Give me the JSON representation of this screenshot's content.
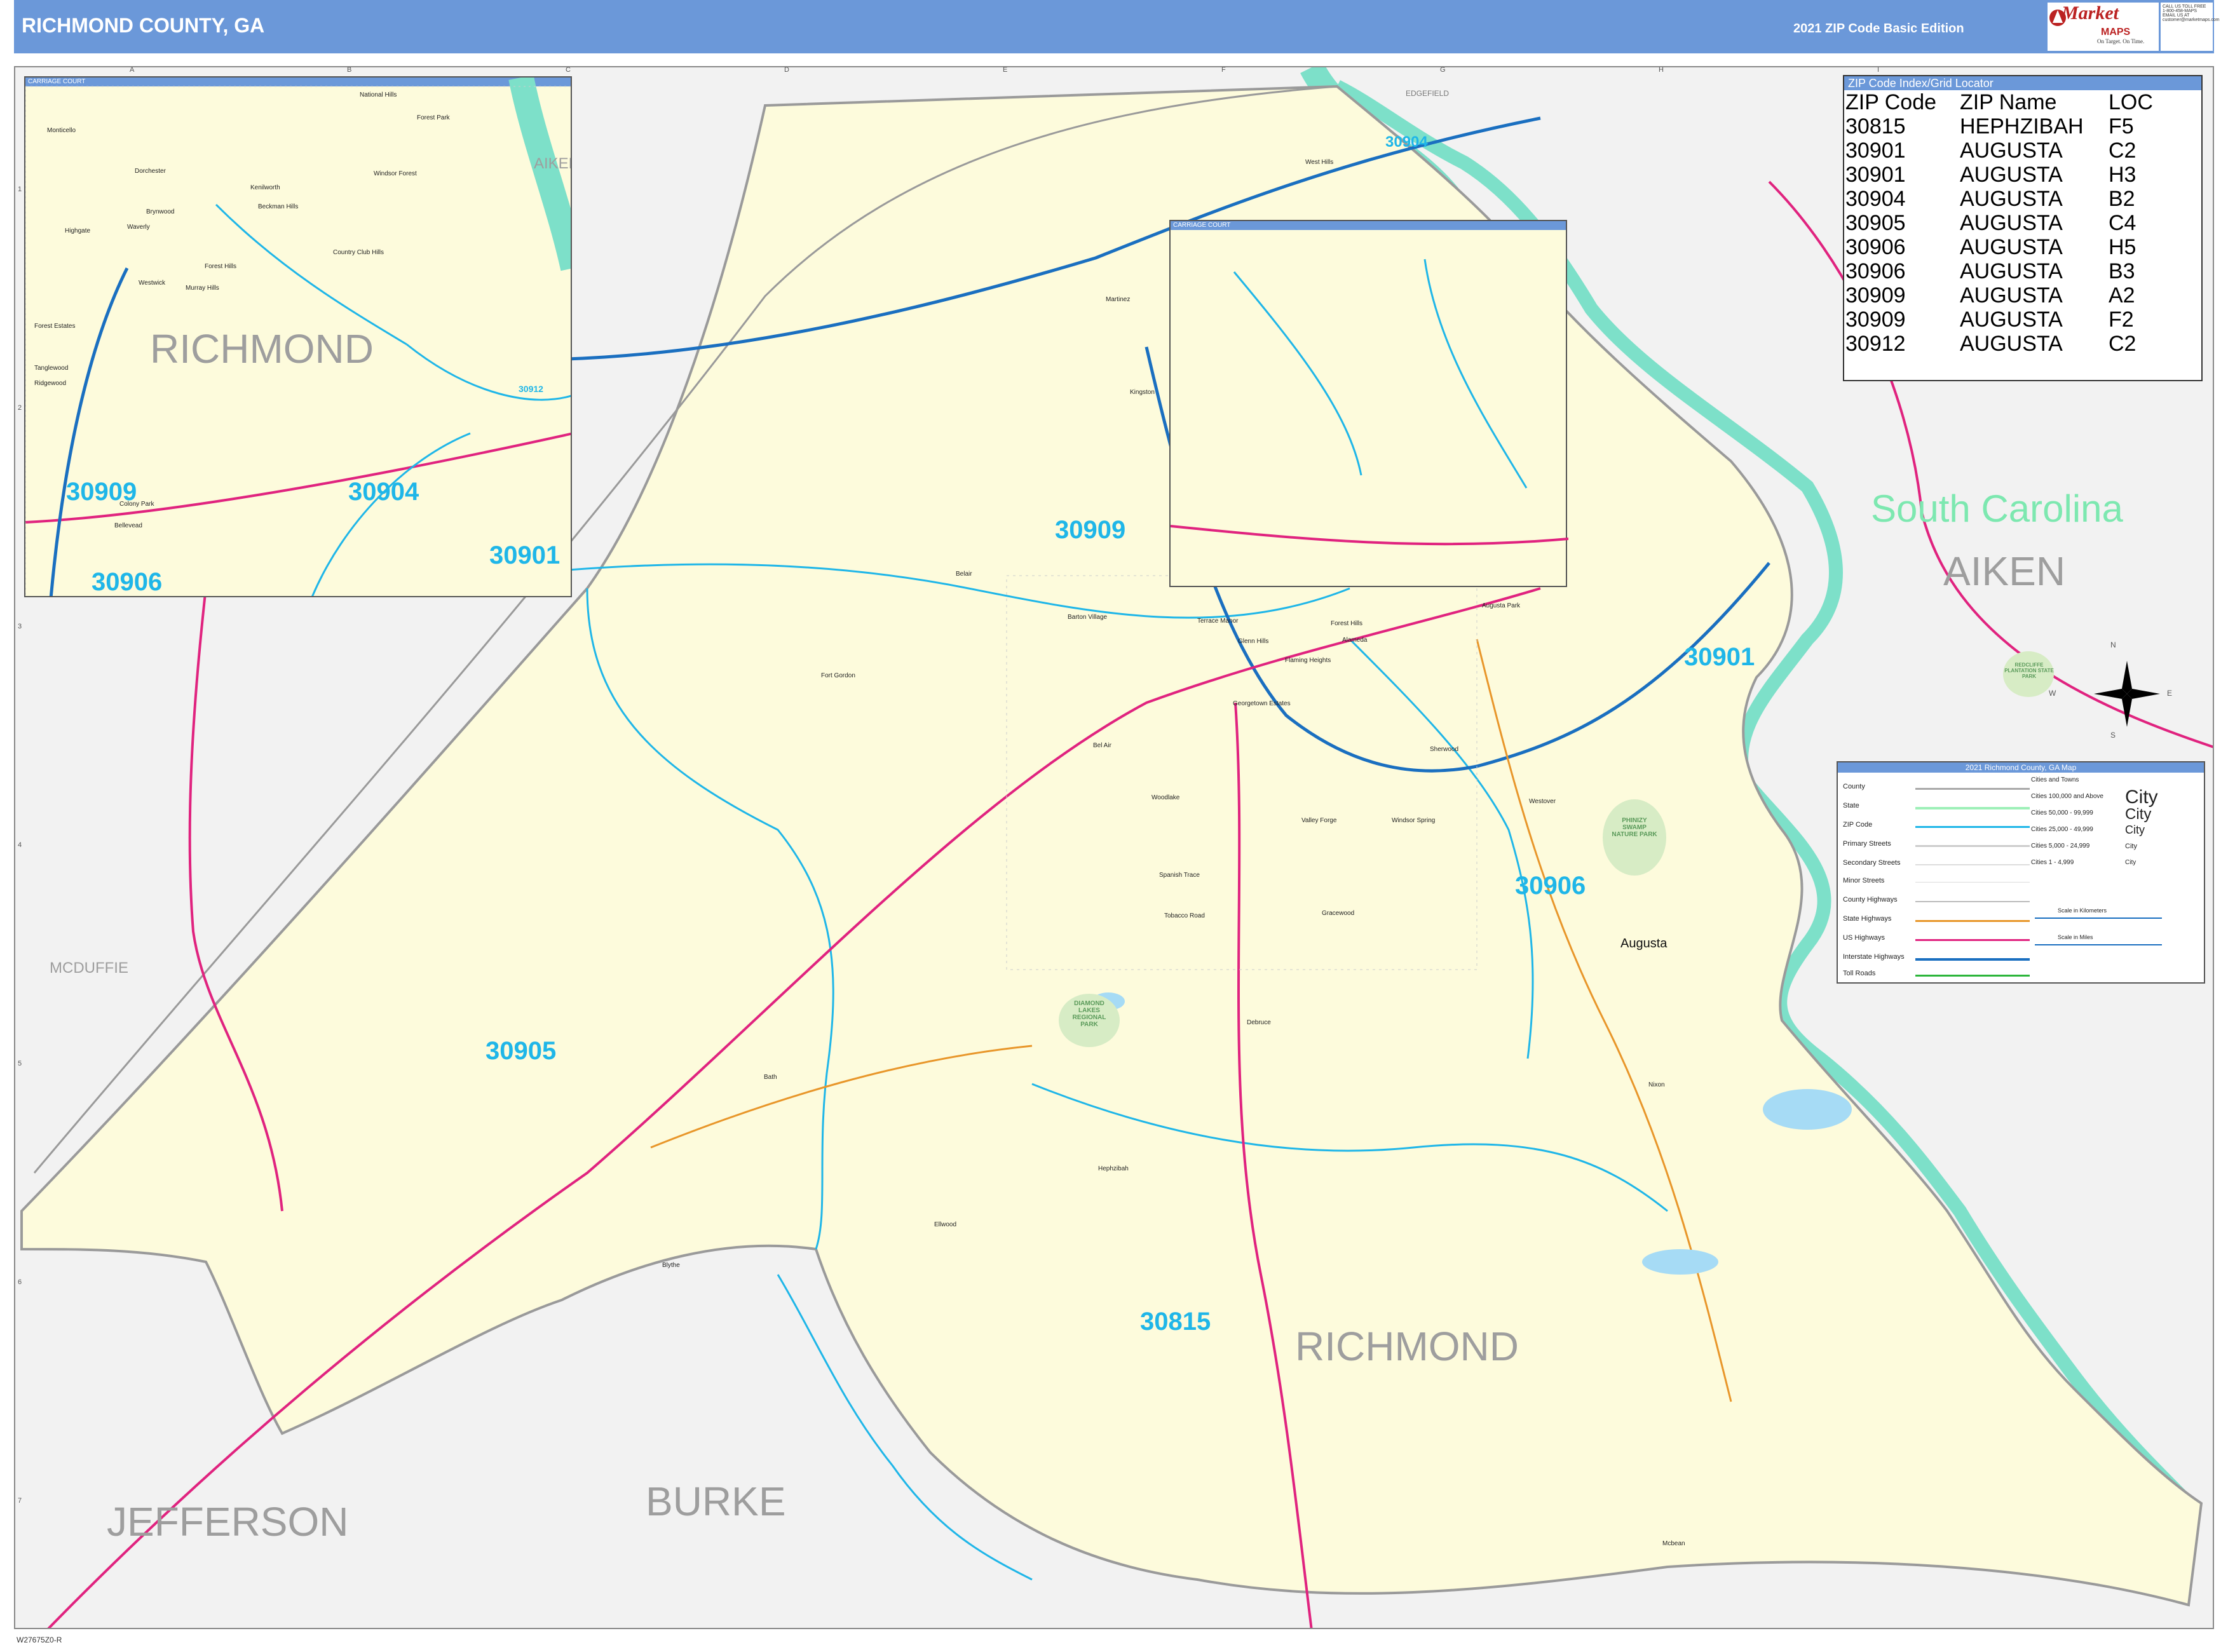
{
  "header": {
    "title": "RICHMOND COUNTY, GA",
    "edition": "2021 ZIP Code Basic Edition",
    "logo_top": "Market",
    "logo_maps": "MAPS",
    "logo_tagline": "On Target. On Time.",
    "logo_sub": "America's Leading Source of Business Maps",
    "contact": "CALL US TOLL FREE\n1-800-458-MAPS\nEMAIL US AT\ncustomer@marketmaps.com"
  },
  "zip_index": {
    "title": "ZIP Code Index/Grid Locator",
    "columns": [
      "ZIP Code",
      "ZIP Name",
      "LOC"
    ],
    "rows": [
      [
        "30815",
        "HEPHZIBAH",
        "F5"
      ],
      [
        "30901",
        "AUGUSTA",
        "C2"
      ],
      [
        "30901",
        "AUGUSTA",
        "H3"
      ],
      [
        "30904",
        "AUGUSTA",
        "B2"
      ],
      [
        "30905",
        "AUGUSTA",
        "C4"
      ],
      [
        "30906",
        "AUGUSTA",
        "H5"
      ],
      [
        "30906",
        "AUGUSTA",
        "B3"
      ],
      [
        "30909",
        "AUGUSTA",
        "A2"
      ],
      [
        "30909",
        "AUGUSTA",
        "F2"
      ],
      [
        "30912",
        "AUGUSTA",
        "C2"
      ]
    ]
  },
  "legend": {
    "title": "2021 Richmond County, GA Map",
    "items": [
      "County",
      "State",
      "ZIP Code",
      "Primary Streets",
      "Secondary Streets",
      "Minor Streets",
      "County Highways",
      "State Highways",
      "US Highways",
      "Interstate Highways",
      "Toll Roads"
    ],
    "cities_title": "Cities and Towns",
    "city_classes": [
      "Cities 100,000 and Above",
      "Cities 50,000 - 99,999",
      "Cities 25,000 - 49,999",
      "Cities 5,000 - 24,999",
      "Cities 1 - 4,999"
    ],
    "city_word": "City",
    "scale_km": "Scale in Kilometers",
    "scale_mi": "Scale in Miles",
    "colors": {
      "county": "#aaaaaa",
      "state": "#9ef0b8",
      "zip": "#1fb6e8",
      "us_hwy": "#e0237f",
      "interstate": "#1a6fc0",
      "state_hwy": "#e8962a",
      "toll": "#2bb53a"
    }
  },
  "map": {
    "zip_labels": [
      "30909",
      "30905",
      "30815",
      "30906",
      "30901",
      "30904"
    ],
    "county_labels": [
      "RICHMOND",
      "JEFFERSON",
      "BURKE",
      "AIKEN",
      "MCDUFFIE"
    ],
    "state_label": "South Carolina",
    "edgefield": "EDGEFIELD",
    "city_augusta": "Augusta",
    "places": [
      "Fort Gordon",
      "Hephzibah",
      "Blythe",
      "Bath",
      "Ellwood",
      "Nixon",
      "Mcbean",
      "Debruce",
      "Gracewood",
      "Woodlake",
      "Spanish Trace",
      "Tobacco Road",
      "Westover",
      "Sherwood",
      "Kingston",
      "Martinez",
      "West Hills",
      "Belair",
      "Barton Village",
      "Terrace Manor",
      "Flaming Heights",
      "Georgetown Estates",
      "Valley Forge",
      "Bel Air",
      "Alameda",
      "Augusta Park",
      "Glenn Hills",
      "Forest Hills",
      "Windsor Spring"
    ],
    "parks": [
      "DIAMOND LAKES REGIONAL PARK",
      "PHINIZY SWAMP NATURE PARK",
      "REDCLIFFE PLANTATION STATE PARK"
    ],
    "grid_cols": [
      "A",
      "B",
      "C",
      "D",
      "E",
      "F",
      "G",
      "H",
      "I"
    ],
    "grid_rows": [
      "1",
      "2",
      "3",
      "4",
      "5",
      "6",
      "7"
    ],
    "compass": [
      "N",
      "E",
      "S",
      "W"
    ]
  },
  "inset_left": {
    "title": "CARRIAGE COURT",
    "county": "RICHMOND",
    "county_aiken": "AIKEN",
    "zips": [
      "30909",
      "30904",
      "30906",
      "30901",
      "30912"
    ],
    "places": [
      "National Hills",
      "Forest Park",
      "Monticello",
      "Dorchester",
      "Windsor Forest",
      "Beckman Hills",
      "Brynwood",
      "Highgate",
      "Waverly",
      "Country Club Hills",
      "Westwick",
      "Murray Hills",
      "Forest Estates",
      "Tanglewood",
      "Ridgewood",
      "Colony Park",
      "Bellevead",
      "Kenilworth",
      "Forest Hills"
    ]
  },
  "inset_right": {
    "title": "CARRIAGE COURT"
  },
  "footer": {
    "code": "W27675Z0-R"
  }
}
